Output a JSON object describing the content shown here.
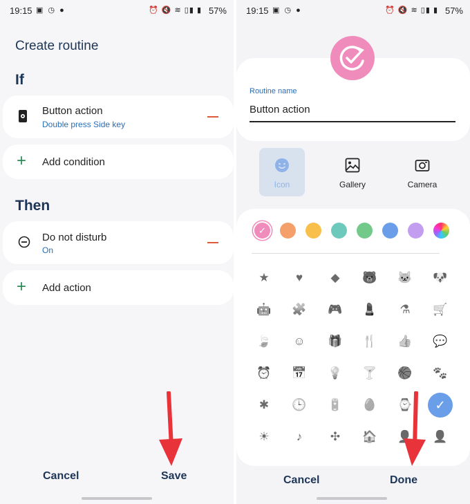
{
  "status_bar": {
    "time": "19:15",
    "battery": "57%",
    "left_icons": "▣ ◷ ●",
    "right_icons": "⏰ 🔇 ≋ ▯▮ ▮"
  },
  "left_screen": {
    "title": "Create routine",
    "if_label": "If",
    "condition": {
      "label": "Button action",
      "sub": "Double press Side key",
      "icon": "phone-gear-icon"
    },
    "add_condition": "Add condition",
    "then_label": "Then",
    "action": {
      "label": "Do not disturb",
      "sub": "On",
      "icon": "dnd-icon"
    },
    "add_action": "Add action",
    "cancel": "Cancel",
    "save": "Save"
  },
  "right_screen": {
    "name_label": "Routine name",
    "name_value": "Button action",
    "tabs": [
      {
        "label": "Icon",
        "icon": "smiley-icon",
        "selected": true
      },
      {
        "label": "Gallery",
        "icon": "gallery-icon",
        "selected": false
      },
      {
        "label": "Camera",
        "icon": "camera-icon",
        "selected": false
      }
    ],
    "swatch_colors": [
      "#f08cbb",
      "#f5a06a",
      "#f8c04a",
      "#6cc9bc",
      "#72c98a",
      "#6a9ee9",
      "#c39ef0",
      "rainbow"
    ],
    "icon_rows": [
      [
        "★",
        "♥",
        "◆",
        "🐻",
        "🐱",
        "🐶"
      ],
      [
        "🤖",
        "🧩",
        "🎮",
        "💄",
        "⚗",
        "🛒"
      ],
      [
        "🍃",
        "☺",
        "🎁",
        "🍴",
        "👍",
        "💬"
      ],
      [
        "⏰",
        "📅",
        "💡",
        "🍸",
        "🏀",
        "🐾"
      ],
      [
        "✱",
        "🕒",
        "🔋",
        "🥚",
        "⌚",
        "✓"
      ],
      [
        "☀",
        "♪",
        "✣",
        "🏠",
        "👤",
        "👤"
      ]
    ],
    "cancel": "Cancel",
    "done": "Done"
  }
}
